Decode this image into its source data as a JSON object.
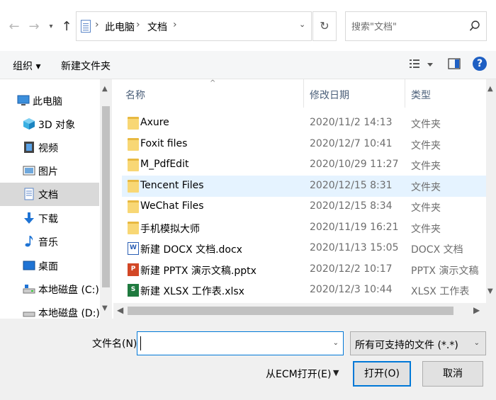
{
  "address": {
    "crumbs": [
      "此电脑",
      "文档"
    ]
  },
  "search": {
    "placeholder": "搜索\"文档\""
  },
  "toolbar": {
    "organize": "组织 ▾",
    "new_folder": "新建文件夹"
  },
  "nav": {
    "items": [
      {
        "label": "此电脑",
        "icon": "computer-icon"
      },
      {
        "label": "3D 对象",
        "icon": "3d-objects-icon"
      },
      {
        "label": "视频",
        "icon": "video-icon"
      },
      {
        "label": "图片",
        "icon": "pictures-icon"
      },
      {
        "label": "文档",
        "icon": "documents-icon"
      },
      {
        "label": "下载",
        "icon": "download-icon"
      },
      {
        "label": "音乐",
        "icon": "music-icon"
      },
      {
        "label": "桌面",
        "icon": "desktop-icon"
      },
      {
        "label": "本地磁盘 (C:)",
        "icon": "drive-icon"
      },
      {
        "label": "本地磁盘 (D:)",
        "icon": "drive-icon"
      }
    ]
  },
  "columns": {
    "name": "名称",
    "modified": "修改日期",
    "type": "类型"
  },
  "files": [
    {
      "name": "Axure",
      "date": "2020/11/2 14:13",
      "type": "文件夹",
      "kind": "folder"
    },
    {
      "name": "Foxit files",
      "date": "2020/12/7 10:41",
      "type": "文件夹",
      "kind": "folder"
    },
    {
      "name": "M_PdfEdit",
      "date": "2020/10/29 11:27",
      "type": "文件夹",
      "kind": "folder"
    },
    {
      "name": "Tencent Files",
      "date": "2020/12/15 8:31",
      "type": "文件夹",
      "kind": "folder"
    },
    {
      "name": "WeChat Files",
      "date": "2020/12/15 8:34",
      "type": "文件夹",
      "kind": "folder"
    },
    {
      "name": "手机模拟大师",
      "date": "2020/11/19 16:21",
      "type": "文件夹",
      "kind": "folder"
    },
    {
      "name": "新建 DOCX 文档.docx",
      "date": "2020/11/13 15:05",
      "type": "DOCX 文档",
      "kind": "docx"
    },
    {
      "name": "新建 PPTX 演示文稿.pptx",
      "date": "2020/12/2 10:17",
      "type": "PPTX 演示文稿",
      "kind": "pptx"
    },
    {
      "name": "新建 XLSX 工作表.xlsx",
      "date": "2020/12/3 10:44",
      "type": "XLSX 工作表",
      "kind": "xlsx"
    }
  ],
  "bottom": {
    "filename_label": "文件名(N):",
    "filename_value": "",
    "filter": "所有可支持的文件 (*.*)",
    "ecm": "从ECM打开(E)",
    "open": "打开(O)",
    "cancel": "取消"
  },
  "colors": {
    "accent": "#0078d7",
    "selected_nav": "#d9d9d9",
    "hover_row": "#e5f3ff",
    "folder": "#f8d775"
  }
}
